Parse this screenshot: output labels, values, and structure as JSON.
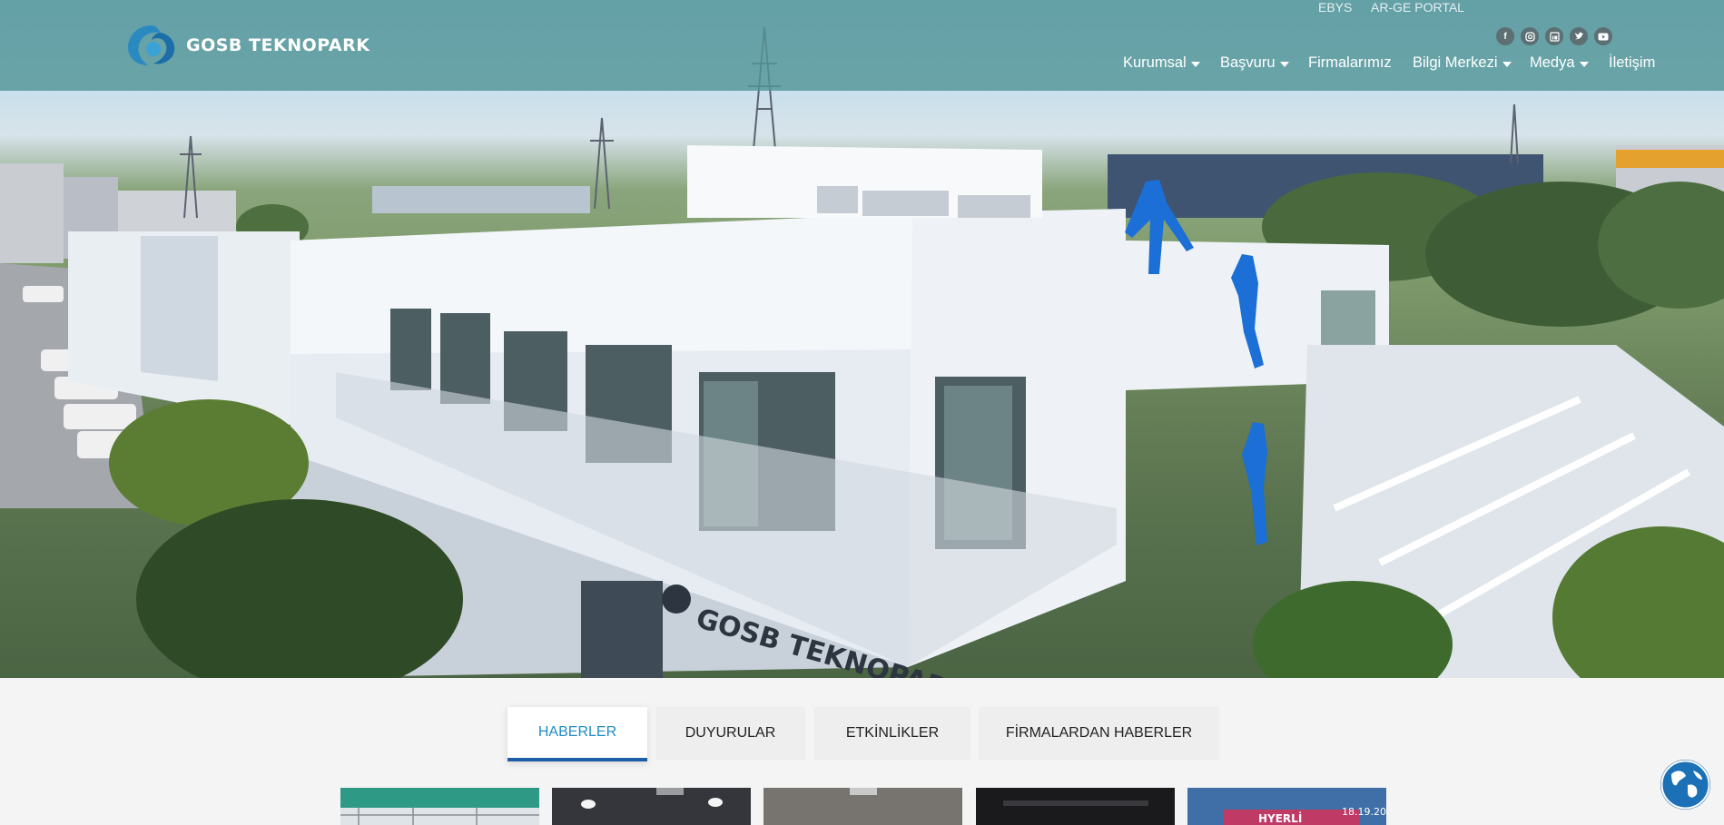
{
  "brand": {
    "name": "GOSB TEKNOPARK",
    "logo_icon": "gosb-swirl-logo",
    "accent": "#2a8ac0"
  },
  "topbar": {
    "links": [
      "EBYS",
      "AR-GE PORTAL"
    ],
    "social": [
      "facebook-icon",
      "instagram-icon",
      "linkedin-icon",
      "twitter-icon",
      "youtube-icon"
    ]
  },
  "nav": {
    "items": [
      {
        "label": "Kurumsal",
        "dropdown": true
      },
      {
        "label": "Başvuru",
        "dropdown": true
      },
      {
        "label": "Firmalarımız",
        "dropdown": false
      },
      {
        "label": "Bilgi Merkezi",
        "dropdown": true
      },
      {
        "label": "Medya",
        "dropdown": true
      },
      {
        "label": "İletişim",
        "dropdown": false
      }
    ]
  },
  "hero": {
    "building_sign": "GOSB TEKNOPARK"
  },
  "tabs": {
    "items": [
      "HABERLER",
      "DUYURULAR",
      "ETKİNLİKLER",
      "FİRMALARDAN HABERLER"
    ],
    "active": "HABERLER"
  },
  "cards": {
    "overlay_text": [
      "HYERLİ",
      "18.19.20"
    ]
  },
  "widgets": {
    "globe_icon": "globe-icon"
  }
}
